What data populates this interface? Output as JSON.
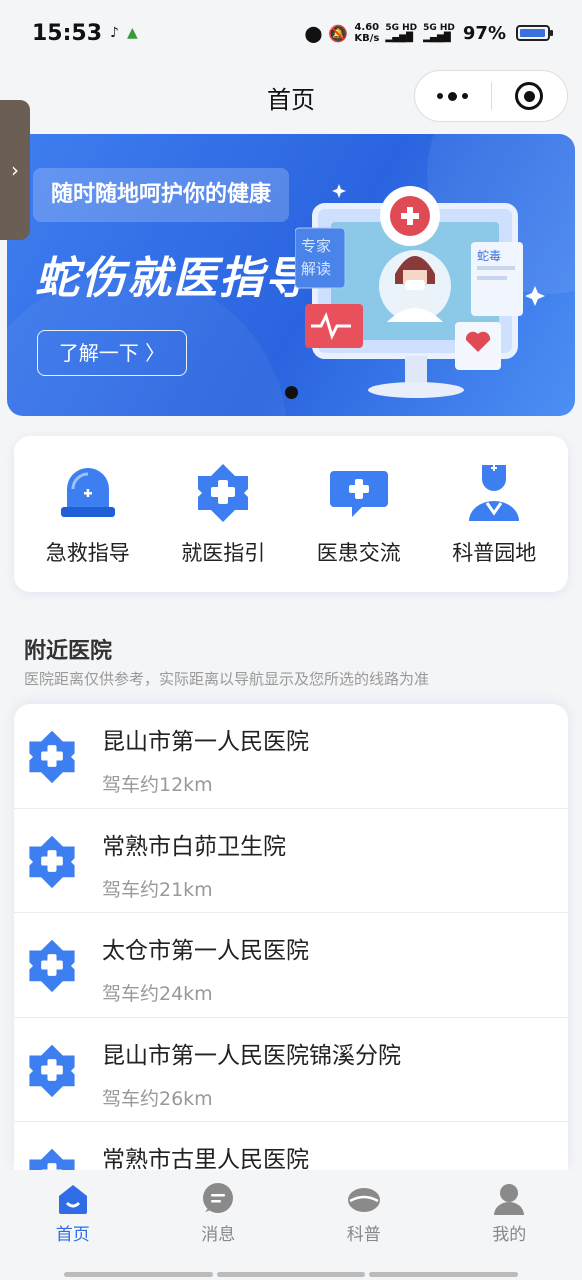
{
  "status_bar": {
    "time": "15:53",
    "net_speed": "4.60",
    "net_unit": "KB/s",
    "signal_1": "5G HD",
    "signal_2": "5G HD",
    "battery": "97%"
  },
  "header": {
    "title": "首页"
  },
  "banner": {
    "subtitle": "随时随地呵护你的健康",
    "title": "蛇伤就医指导",
    "button_label": "了解一下 〉",
    "art_text_1": "专家",
    "art_text_2": "解读",
    "art_text_3": "蛇毒"
  },
  "quick_actions": [
    {
      "label": "急救指导",
      "icon": "ambulance-light-icon"
    },
    {
      "label": "就医指引",
      "icon": "medical-cross-icon"
    },
    {
      "label": "医患交流",
      "icon": "chat-cross-icon"
    },
    {
      "label": "科普园地",
      "icon": "nurse-icon"
    }
  ],
  "nearby": {
    "title": "附近医院",
    "note": "医院距离仅供参考，实际距离以导航显示及您所选的线路为准",
    "hospitals": [
      {
        "name": "昆山市第一人民医院",
        "distance": "驾车约12km"
      },
      {
        "name": "常熟市白茆卫生院",
        "distance": "驾车约21km"
      },
      {
        "name": "太仓市第一人民医院",
        "distance": "驾车约24km"
      },
      {
        "name": "昆山市第一人民医院锦溪分院",
        "distance": "驾车约26km"
      },
      {
        "name": "常熟市古里人民医院",
        "distance": ""
      }
    ]
  },
  "tab_bar": [
    {
      "label": "首页",
      "icon": "home-icon",
      "active": true
    },
    {
      "label": "消息",
      "icon": "message-icon",
      "active": false
    },
    {
      "label": "科普",
      "icon": "science-icon",
      "active": false
    },
    {
      "label": "我的",
      "icon": "profile-icon",
      "active": false
    }
  ],
  "colors": {
    "accent": "#2e6de6",
    "banner": "#3570e6",
    "background": "#f4f5f7"
  }
}
